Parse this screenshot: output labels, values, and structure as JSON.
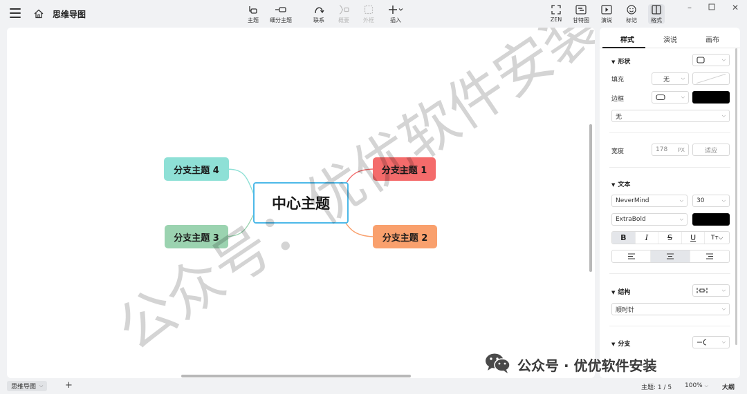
{
  "app": {
    "title": "思维导图"
  },
  "toolbar": {
    "topic": "主题",
    "subtopic": "细分主题",
    "relation": "联系",
    "summary": "概要",
    "boundary": "外框",
    "insert": "插入",
    "zen": "ZEN",
    "gantt": "甘特图",
    "present": "演说",
    "marker": "标记",
    "format": "格式"
  },
  "mindmap": {
    "central": "中心主题",
    "branches": [
      {
        "label": "分支主题 1",
        "color": "#f46b6b"
      },
      {
        "label": "分支主题 2",
        "color": "#f9a06d"
      },
      {
        "label": "分支主题 3",
        "color": "#9bd3b0"
      },
      {
        "label": "分支主题 4",
        "color": "#8ee0d6"
      }
    ]
  },
  "panel": {
    "tabs": [
      "样式",
      "演说",
      "画布"
    ],
    "shape": {
      "title": "形状",
      "fill_label": "填充",
      "fill_value": "无",
      "border_label": "边框",
      "border_style": "无"
    },
    "width": {
      "label": "宽度",
      "value": "178",
      "unit": "PX",
      "fit": "适应"
    },
    "text": {
      "title": "文本",
      "font": "NeverMind",
      "size": "30",
      "weight": "ExtraBold"
    },
    "structure": {
      "title": "结构",
      "value": "顺时针"
    },
    "branch": {
      "title": "分支"
    }
  },
  "statusbar": {
    "sheet": "思维导图",
    "topic_count": "主题: 1 / 5",
    "zoom": "100%",
    "outline": "大纲"
  },
  "watermark": {
    "text": "公众号：优优软件安装",
    "footer": "公众号 · 优优软件安装"
  },
  "colors": {
    "accent": "#4cb8e8",
    "branch1": "#f46b6b",
    "branch2": "#f9a06d",
    "branch3": "#9bd3b0",
    "branch4": "#8ee0d6"
  }
}
